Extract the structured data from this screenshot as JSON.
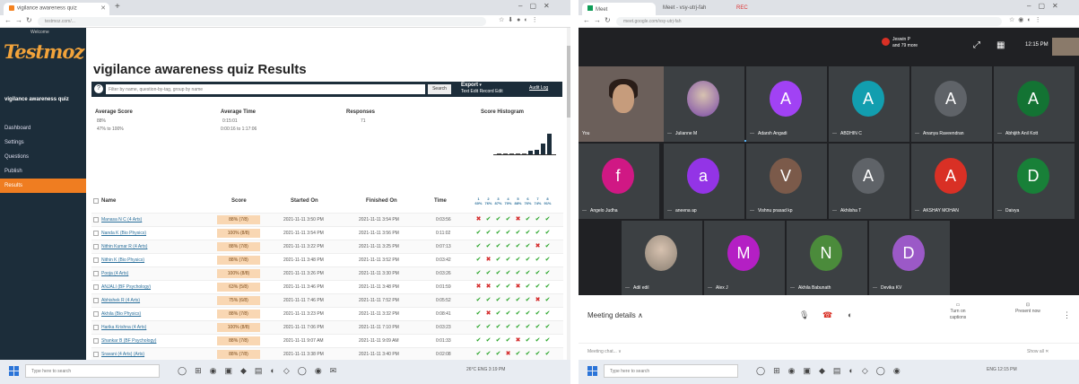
{
  "left": {
    "tab_title": "vigilance awareness quiz",
    "url": "testmoz.com/...",
    "logo_small": "Welcome",
    "logo": "Testmoz",
    "quiz_name": "vigilance awareness quiz",
    "sidebar": [
      "Dashboard",
      "Settings",
      "Questions",
      "Publish",
      "Results"
    ],
    "page_title": "vigilance awareness quiz Results",
    "search_placeholder": "Filter by name, question-by-tag, group by name",
    "search_button": "Search",
    "export_label": "Export",
    "export_sub": "Text Edit  Record Edit",
    "audit_log": "Audit Log",
    "stats": {
      "avg_score_label": "Average Score",
      "avg_score_value": "88%",
      "avg_score_sub": "47% to 100%",
      "avg_time_label": "Average Time",
      "avg_time_value": "0:15:01",
      "avg_time_sub": "0:00:16 to 1:17:06",
      "responses_label": "Responses",
      "responses_value": "71",
      "histogram_label": "Score Histogram"
    },
    "histogram_values": [
      0,
      0,
      0,
      0,
      0.05,
      0.15,
      0.2,
      0.45,
      0.9
    ],
    "columns": {
      "name": "Name",
      "score": "Score",
      "started": "Started On",
      "finished": "Finished On",
      "time": "Time"
    },
    "pct_headers": [
      "1 60%",
      "2 76%",
      "3 87%",
      "4 70%",
      "5 88%",
      "6 76%",
      "7 74%",
      "8 91%"
    ],
    "rows": [
      {
        "name": "Manasa N C (4 Arts)",
        "score": "88% (7/8)",
        "started": "2021-11-11 3:50 PM",
        "finished": "2021-11-11 3:54 PM",
        "time": "0:03:56",
        "marks": "✖✔✔✔✖✔✔✔"
      },
      {
        "name": "Nanda K (Bio Physics)",
        "score": "100% (8/8)",
        "started": "2021-11-11 3:54 PM",
        "finished": "2021-11-11 3:56 PM",
        "time": "0:11:02",
        "marks": "✔✔✔✔✔✔✔✔"
      },
      {
        "name": "Nithin Kumar R (4 Arts)",
        "score": "88% (7/8)",
        "started": "2021-11-11 3:22 PM",
        "finished": "2021-11-11 3:25 PM",
        "time": "0:07:13",
        "marks": "✔✔✔✔✔✔✖✔"
      },
      {
        "name": "Nithin K (Bio Physics)",
        "score": "88% (7/8)",
        "started": "2021-11-11 3:48 PM",
        "finished": "2021-11-11 3:52 PM",
        "time": "0:03:42",
        "marks": "✔✖✔✔✔✔✔✔"
      },
      {
        "name": "Pooja (4 Arts)",
        "score": "100% (8/8)",
        "started": "2021-11-11 3:26 PM",
        "finished": "2021-11-11 3:30 PM",
        "time": "0:03:26",
        "marks": "✔✔✔✔✔✔✔✔"
      },
      {
        "name": "ANJALI (BF Psychology)",
        "score": "63% (5/8)",
        "started": "2021-11-11 3:46 PM",
        "finished": "2021-11-11 3:48 PM",
        "time": "0:01:59",
        "marks": "✖✖✔✔✖✔✔✔"
      },
      {
        "name": "Abhishek R (4 Arts)",
        "score": "75% (6/8)",
        "started": "2021-11-11 7:46 PM",
        "finished": "2021-11-11 7:52 PM",
        "time": "0:05:52",
        "marks": "✔✔✔✔✔✔✖✔"
      },
      {
        "name": "Akhila (Bio Physics)",
        "score": "88% (7/8)",
        "started": "2021-11-11 3:23 PM",
        "finished": "2021-11-11 3:32 PM",
        "time": "0:08:41",
        "marks": "✔✖✔✔✔✔✔✔"
      },
      {
        "name": "Harika Krishna (4 Arts)",
        "score": "100% (8/8)",
        "started": "2021-11-11 7:06 PM",
        "finished": "2021-11-11 7:10 PM",
        "time": "0:03:23",
        "marks": "✔✔✔✔✔✔✔✔"
      },
      {
        "name": "Shankar B (BF Psychology)",
        "score": "88% (7/8)",
        "started": "2021-11-11 9:07 AM",
        "finished": "2021-11-11 9:09 AM",
        "time": "0:01:33",
        "marks": "✔✔✔✔✖✔✔✔"
      },
      {
        "name": "Sravani (4 Arts) (Arts)",
        "score": "88% (7/8)",
        "started": "2021-11-11 3:38 PM",
        "finished": "2021-11-11 3:40 PM",
        "time": "0:02:08",
        "marks": "✔✔✔✖✔✔✔✔"
      }
    ],
    "taskbar_search": "Type here to search",
    "tray": "26°C  ENG  3:19 PM"
  },
  "right": {
    "tab1": "Meet",
    "tab2": "Meet - vsy-utrj-fah",
    "tab3": "REC",
    "url": "meet.google.com/vsy-utrj-fah",
    "pinned_label": "Jeswin P",
    "pinned_sub": "and 79 more",
    "clock": "12:15 PM",
    "self_name": "You",
    "participants": [
      {
        "name": "Julianne M",
        "initial": "",
        "color": "#7b4aa8"
      },
      {
        "name": "Adarsh Angadi",
        "initial": "A",
        "color": "#a142f4"
      },
      {
        "name": "ABDHIN C",
        "initial": "A",
        "color": "#129eaf"
      },
      {
        "name": "Ananya Raveendran",
        "initial": "A",
        "color": "#5f6368"
      },
      {
        "name": "Abhijith Anil Kott",
        "initial": "A",
        "color": "#137333"
      },
      {
        "name": "Angelo Judha",
        "initial": "f",
        "color": "#d01884"
      },
      {
        "name": "aneena ap",
        "initial": "a",
        "color": "#9334e6"
      },
      {
        "name": "Vishnu prasad kp",
        "initial": "V",
        "color": "#7b5a4a"
      },
      {
        "name": "Akhilsha T",
        "initial": "A",
        "color": "#5f6368"
      },
      {
        "name": "AKSHAY MOHAN",
        "initial": "A",
        "color": "#d93025"
      },
      {
        "name": "Daivya",
        "initial": "D",
        "color": "#188038"
      },
      {
        "name": "Adil edil",
        "initial": "",
        "color": "#8a7f72"
      },
      {
        "name": "Alex J",
        "initial": "M",
        "color": "#b41fc4"
      },
      {
        "name": "Akhila Babunath",
        "initial": "N",
        "color": "#4b8b3b"
      },
      {
        "name": "Devika KV",
        "initial": "D",
        "color": "#9b59c7"
      }
    ],
    "meeting_details": "Meeting details",
    "captions": "Turn on captions",
    "present": "Present now",
    "notif": "Meeting chat...  ∨",
    "show_all": "Show all  ✕",
    "taskbar_search": "Type here to search",
    "tray": "ENG  12:15 PM"
  },
  "colors": {
    "sidebar": "#1c2d3a",
    "accent": "#ef7d21",
    "score_bg": "#f9d7b3",
    "ok": "#27a427",
    "bad": "#d42a2a"
  }
}
